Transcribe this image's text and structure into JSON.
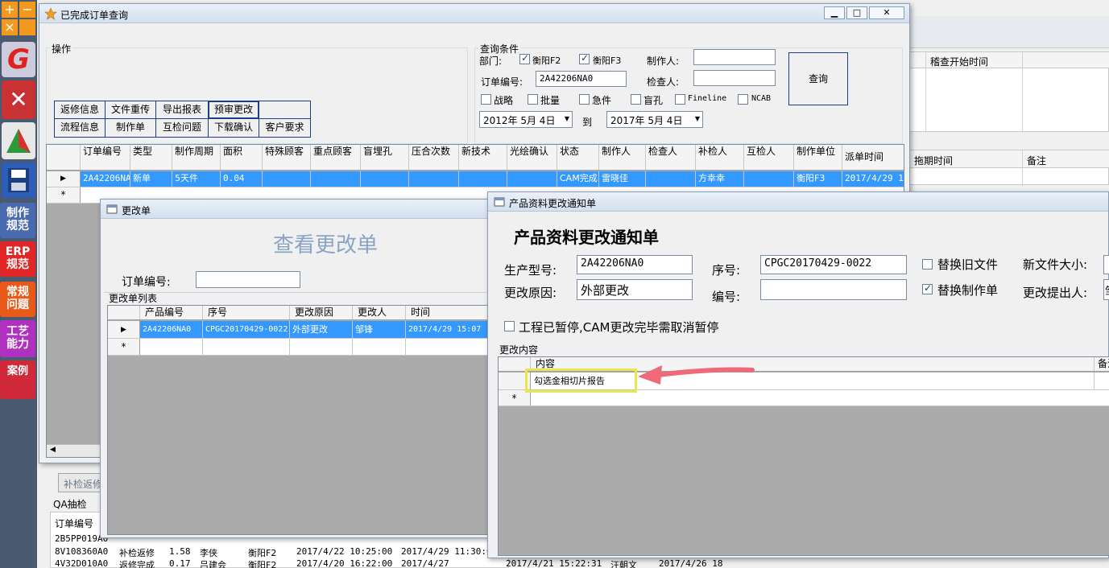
{
  "sidebar": {
    "labels": [
      "制作\n规范",
      "ERP\n规范",
      "常规\n问题",
      "工艺\n能力",
      "案例"
    ],
    "plus": "+",
    "minus": "−",
    "close": "×"
  },
  "bg": {
    "col_check_start": "稽查开始时间",
    "col_delay": "拖期时间",
    "col_note": "备注",
    "btn_recheck": "补检返修",
    "qa_label": "QA抽检",
    "qa_col_order": "订单编号",
    "qa_rows": [
      [
        "2B5PP019A0"
      ],
      [
        "8V108360A0",
        "补检返修",
        "1.58",
        "李侠",
        "衡阳F2",
        "2017/4/22 10:25:00",
        "2017/4/29 11:30:00"
      ],
      [
        "4V32D010A0",
        "返修完成",
        "0.17",
        "吕建会",
        "衡阳F2",
        "2017/4/20 16:22:00",
        "2017/4/27",
        "2017/4/21 15:22:31",
        "汪朝文",
        "2017/4/26 18"
      ]
    ]
  },
  "main": {
    "title": "已完成订单查询",
    "ops_label": "操作",
    "buttons": [
      [
        "返修信息",
        "文件重传",
        "导出报表",
        "预审更改"
      ],
      [
        "流程信息",
        "制作单",
        "互检问题",
        "下载确认",
        "客户要求"
      ]
    ],
    "query": {
      "label": "查询条件",
      "dept": "部门:",
      "dept_opt1": "衡阳F2",
      "dept_opt2": "衡阳F3",
      "maker": "制作人:",
      "order_no": "订单编号:",
      "order_value": "2A42206NA0",
      "checker": "检查人:",
      "flags": [
        "战略",
        "批量",
        "急件",
        "盲孔",
        "Fineline",
        "NCAB"
      ],
      "date_from": "2012年 5月 4日",
      "to": "到",
      "date_to": "2017年 5月 4日",
      "search": "查询"
    },
    "cols": [
      "订单编号",
      "类型",
      "制作周期",
      "面积",
      "特殊顾客",
      "重点顾客",
      "盲埋孔",
      "压合次数",
      "新技术",
      "光绘确认",
      "状态",
      "制作人",
      "检查人",
      "补检人",
      "互检人",
      "制作单位",
      "派单时间"
    ],
    "row": [
      "2A42206NA0",
      "新单",
      "5天件",
      "0.04",
      "",
      "",
      "",
      "",
      "",
      "",
      "CAM完成",
      "雷晓佳",
      "",
      "方幸幸",
      "",
      "衡阳F3",
      "2017/4/29 1"
    ]
  },
  "change": {
    "title": "更改单",
    "heading": "查看更改单",
    "order_label": "订单编号:",
    "list_label": "更改单列表",
    "cols": [
      "产品编号",
      "序号",
      "更改原因",
      "更改人",
      "时间"
    ],
    "row": [
      "2A42206NA0",
      "CPGC20170429-0022",
      "外部更改",
      "邹锋",
      "2017/4/29 15:07"
    ]
  },
  "notice": {
    "title": "产品资料更改通知单",
    "heading": "产品资料更改通知单",
    "model_label": "生产型号:",
    "model": "2A42206NA0",
    "seq_label": "序号:",
    "seq": "CPGC20170429-0022",
    "reason_label": "更改原因:",
    "reason": "外部更改",
    "code_label": "编号:",
    "replace_old": "替换旧文件",
    "replace_card": "替换制作单",
    "new_size": "新文件大小:",
    "proposer": "更改提出人:",
    "proposer_cut": "邹",
    "paused": "工程已暂停,CAM更改完毕需取消暂停",
    "content_label": "更改内容",
    "cols": [
      "内容",
      "备注"
    ],
    "row": "勾选金相切片报告"
  },
  "colors": {
    "accent": "#3399ff",
    "highlight": "#e8e84a",
    "arrow": "#ef6a78"
  }
}
